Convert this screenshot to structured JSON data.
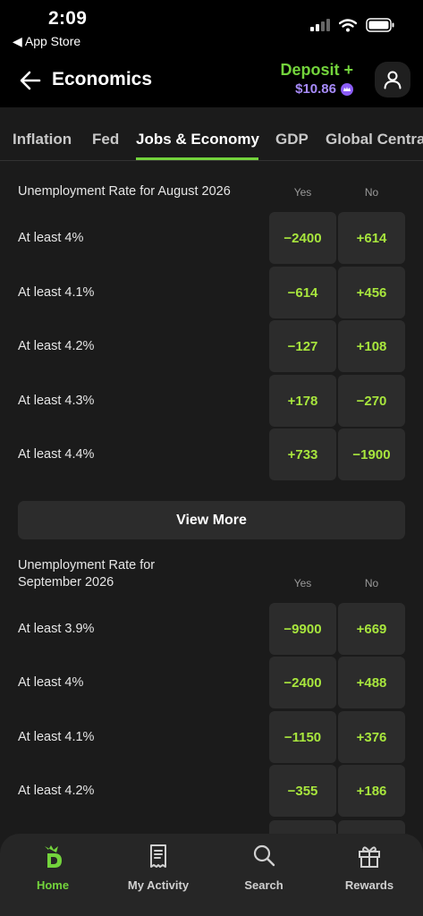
{
  "status": {
    "time": "2:09",
    "back_app": "◀ App Store"
  },
  "header": {
    "title": "Economics",
    "deposit_label": "Deposit +",
    "balance": "$10.86"
  },
  "tabs": [
    "Inflation",
    "Fed",
    "Jobs & Economy",
    "GDP",
    "Global Centra"
  ],
  "section1": {
    "title": "Unemployment Rate for August 2026",
    "yes_label": "Yes",
    "no_label": "No",
    "rows": [
      {
        "label": "At least 4%",
        "yes": "−2400",
        "no": "+614"
      },
      {
        "label": "At least 4.1%",
        "yes": "−614",
        "no": "+456"
      },
      {
        "label": "At least 4.2%",
        "yes": "−127",
        "no": "+108"
      },
      {
        "label": "At least 4.3%",
        "yes": "+178",
        "no": "−270"
      },
      {
        "label": "At least 4.4%",
        "yes": "+733",
        "no": "−1900"
      }
    ]
  },
  "view_more": "View More",
  "section2": {
    "title_line1": "Unemployment Rate for",
    "title_line2": "September 2026",
    "yes_label": "Yes",
    "no_label": "No",
    "rows": [
      {
        "label": "At least 3.9%",
        "yes": "−9900",
        "no": "+669"
      },
      {
        "label": "At least 4%",
        "yes": "−2400",
        "no": "+488"
      },
      {
        "label": "At least 4.1%",
        "yes": "−1150",
        "no": "+376"
      },
      {
        "label": "At least 4.2%",
        "yes": "−355",
        "no": "+186"
      }
    ]
  },
  "nav": [
    {
      "label": "Home",
      "icon": "home-logo-icon",
      "active": true
    },
    {
      "label": "My Activity",
      "icon": "receipt-icon"
    },
    {
      "label": "Search",
      "icon": "search-icon"
    },
    {
      "label": "Rewards",
      "icon": "gift-icon"
    }
  ],
  "colors": {
    "accent_green": "#73d33c",
    "odds_green": "#a8e63d",
    "balance_purple": "#a78bfa",
    "background": "#1b1b1b"
  }
}
